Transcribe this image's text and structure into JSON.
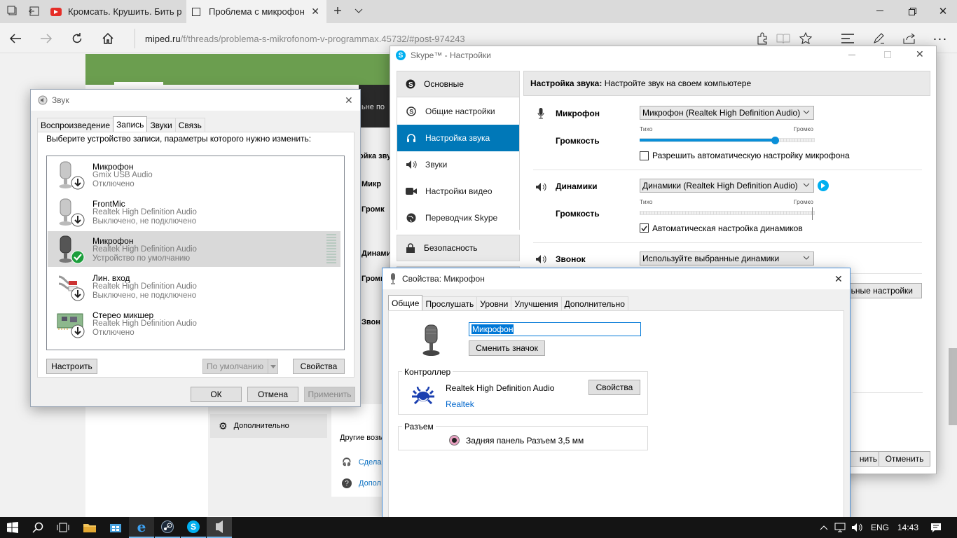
{
  "browser": {
    "tabs": [
      {
        "title": "Кромсать. Крушить. Бить р"
      },
      {
        "title": "Проблема с микрофон"
      }
    ],
    "url": {
      "host": "miped.ru",
      "path": "/f/threads/problema-s-mikrofonom-v-programmax.45732/#post-974243"
    }
  },
  "background_page": {
    "frag_bad": "ьне по",
    "frag_sound": "ойка зву",
    "frag_mic": "Микр",
    "frag_vol": "Громк",
    "frag_dyn": "Динами",
    "frag_vol2": "Громк",
    "frag_ring": "Звон",
    "advanced": "Дополнительно",
    "other": "Другие возм",
    "link1": "Сдела",
    "link2": "Допол"
  },
  "sound_dialog": {
    "title": "Звук",
    "tabs": [
      "Воспроизведение",
      "Запись",
      "Звуки",
      "Связь"
    ],
    "active_tab": 1,
    "instruction": "Выберите устройство записи, параметры которого нужно изменить:",
    "devices": [
      {
        "name": "Микрофон",
        "driver": "Gmix USB Audio",
        "status": "Отключено",
        "icon": "mic-icon"
      },
      {
        "name": "FrontMic",
        "driver": "Realtek High Definition Audio",
        "status": "Выключено, не подключено",
        "icon": "mic-icon"
      },
      {
        "name": "Микрофон",
        "driver": "Realtek High Definition Audio",
        "status": "Устройство по умолчанию",
        "icon": "mic-icon",
        "selected": true
      },
      {
        "name": "Лин. вход",
        "driver": "Realtek High Definition Audio",
        "status": "Выключено, не подключено",
        "icon": "rca-cable-icon"
      },
      {
        "name": "Стерео микшер",
        "driver": "Realtek High Definition Audio",
        "status": "Отключено",
        "icon": "circuit-board-icon"
      }
    ],
    "buttons": {
      "configure": "Настроить",
      "set_default": "По умолчанию",
      "properties": "Свойства",
      "ok": "ОК",
      "cancel": "Отмена",
      "apply": "Применить"
    }
  },
  "skype": {
    "title": "Skype™ - Настройки",
    "nav": {
      "main": "Основные",
      "items": [
        "Общие настройки",
        "Настройка звука",
        "Звуки",
        "Настройки видео",
        "Переводчик Skype"
      ],
      "security": "Безопасность"
    },
    "header_bold": "Настройка звука:",
    "header_text": "Настройте звук на своем компьютере",
    "mic_label": "Микрофон",
    "mic_device": "Микрофон (Realtek High Definition Audio)",
    "volume_label": "Громкость",
    "quiet": "Тихо",
    "loud": "Громко",
    "mic_volume": 0.77,
    "auto_mic": "Разрешить автоматическую настройку микрофона",
    "speakers_label": "Динамики",
    "speakers_device": "Динамики (Realtek High Definition Audio)",
    "speakers_volume": 1.0,
    "auto_speakers": "Автоматическая настройка динамиков",
    "ring_label": "Звонок",
    "ring_device": "Используйте выбранные динамики",
    "more_settings": "льные настройки",
    "save_partial": "нить",
    "cancel": "Отменить"
  },
  "mic_props": {
    "title": "Свойства: Микрофон",
    "tabs": [
      "Общие",
      "Прослушать",
      "Уровни",
      "Улучшения",
      "Дополнительно"
    ],
    "name_value": "Микрофон",
    "change_icon": "Сменить значок",
    "controller_label": "Контроллер",
    "controller_name": "Realtek High Definition Audio",
    "controller_vendor": "Realtek",
    "controller_props": "Свойства",
    "jack_label": "Разъем",
    "jack_text": "Задняя панель Разъем 3,5 мм"
  },
  "taskbar": {
    "lang": "ENG",
    "time": "14:43"
  }
}
